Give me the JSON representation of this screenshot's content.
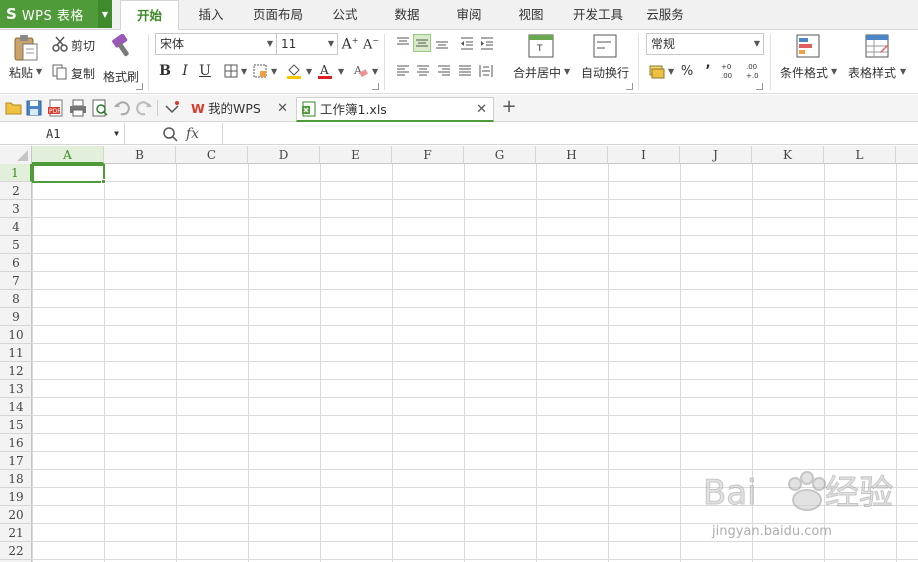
{
  "app": {
    "logo": "S",
    "name": "WPS 表格"
  },
  "menu_tabs": [
    {
      "label": "开始",
      "active": true
    },
    {
      "label": "插入"
    },
    {
      "label": "页面布局"
    },
    {
      "label": "公式"
    },
    {
      "label": "数据"
    },
    {
      "label": "审阅"
    },
    {
      "label": "视图"
    },
    {
      "label": "开发工具"
    },
    {
      "label": "云服务"
    }
  ],
  "ribbon": {
    "paste_label": "粘贴",
    "cut_label": "剪切",
    "copy_label": "复制",
    "format_painter_label": "格式刷",
    "font_name": "宋体",
    "font_size": "11",
    "bold": "B",
    "italic": "I",
    "underline": "U",
    "merge_center_label": "合并居中",
    "wrap_text_label": "自动换行",
    "number_format": "常规",
    "percent": "%",
    "comma": "’",
    "cond_format_label": "条件格式",
    "table_style_label": "表格样式"
  },
  "doc_tabs": [
    {
      "label": "我的WPS",
      "active": false
    },
    {
      "label": "工作簿1.xls",
      "active": true
    }
  ],
  "formula_bar": {
    "cell_ref": "A1",
    "fx_label": "fx",
    "formula": ""
  },
  "sheet": {
    "columns": [
      "A",
      "B",
      "C",
      "D",
      "E",
      "F",
      "G",
      "H",
      "I",
      "J",
      "K",
      "L"
    ],
    "rows": [
      "1",
      "2",
      "3",
      "4",
      "5",
      "6",
      "7",
      "8",
      "9",
      "10",
      "11",
      "12",
      "13",
      "14",
      "15",
      "16",
      "17",
      "18",
      "19",
      "20",
      "21",
      "22"
    ],
    "selected_cell": "A1"
  },
  "watermark": {
    "brand": "Bai du 经验",
    "url": "jingyan.baidu.com"
  },
  "colors": {
    "accent": "#4f9b3a",
    "selected_header_bg": "#e2efda",
    "font_color_red": "#e02020",
    "fill_yellow": "#f5c800"
  }
}
